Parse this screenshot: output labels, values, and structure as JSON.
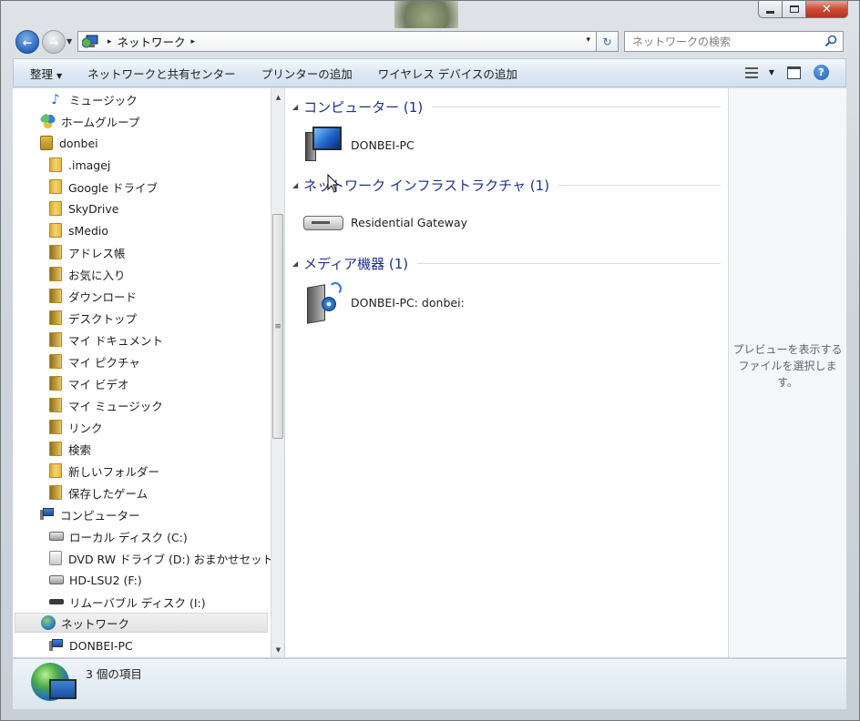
{
  "window": {
    "caption": {
      "minimize": "—",
      "maximize": "□",
      "close": "✕"
    }
  },
  "address": {
    "segments": [
      "ネットワーク"
    ],
    "separator": "▸",
    "dropdown": "▾",
    "refresh": "↻"
  },
  "search": {
    "placeholder": "ネットワークの検索"
  },
  "commandbar": {
    "items": [
      "整理",
      "ネットワークと共有センター",
      "プリンターの追加",
      "ワイヤレス デバイスの追加"
    ],
    "organize_arrow": "▼",
    "view_arrow": "▼",
    "help": "?"
  },
  "navpane": {
    "items": [
      {
        "label": "ミュージック",
        "icon": "music-note-icon"
      },
      {
        "label": "ホームグループ",
        "icon": "homegroup-icon"
      },
      {
        "label": "donbei",
        "icon": "user-folder-icon"
      },
      {
        "label": ".imagej",
        "icon": "folder-icon"
      },
      {
        "label": "Google ドライブ",
        "icon": "folder-icon"
      },
      {
        "label": "SkyDrive",
        "icon": "folder-icon"
      },
      {
        "label": "sMedio",
        "icon": "folder-icon"
      },
      {
        "label": "アドレス帳",
        "icon": "contacts-folder-icon"
      },
      {
        "label": "お気に入り",
        "icon": "favorites-folder-icon"
      },
      {
        "label": "ダウンロード",
        "icon": "downloads-folder-icon"
      },
      {
        "label": "デスクトップ",
        "icon": "desktop-folder-icon"
      },
      {
        "label": "マイ ドキュメント",
        "icon": "documents-folder-icon"
      },
      {
        "label": "マイ ピクチャ",
        "icon": "pictures-folder-icon"
      },
      {
        "label": "マイ ビデオ",
        "icon": "videos-folder-icon"
      },
      {
        "label": "マイ ミュージック",
        "icon": "music-folder-icon"
      },
      {
        "label": "リンク",
        "icon": "links-folder-icon"
      },
      {
        "label": "検索",
        "icon": "searches-folder-icon"
      },
      {
        "label": "新しいフォルダー",
        "icon": "folder-icon"
      },
      {
        "label": "保存したゲーム",
        "icon": "saved-games-folder-icon"
      },
      {
        "label": "コンピューター",
        "icon": "computer-icon"
      },
      {
        "label": "ローカル ディスク (C:)",
        "icon": "local-disk-icon"
      },
      {
        "label": "DVD RW ドライブ (D:) おまかせセット",
        "icon": "dvd-drive-icon"
      },
      {
        "label": "HD-LSU2 (F:)",
        "icon": "hard-drive-icon"
      },
      {
        "label": "リムーバブル ディスク (I:)",
        "icon": "removable-disk-icon"
      },
      {
        "label": "ネットワーク",
        "icon": "network-icon",
        "selected": true
      },
      {
        "label": "DONBEI-PC",
        "icon": "computer-icon"
      }
    ],
    "scroll_grip": "≡",
    "scroll_up": "▲",
    "scroll_down": "▼"
  },
  "content": {
    "groups": [
      {
        "title": "コンピューター (1)",
        "items": [
          {
            "label": "DONBEI-PC",
            "icon": "computer-icon"
          }
        ]
      },
      {
        "title": "ネットワーク インフラストラクチャ (1)",
        "items": [
          {
            "label": "Residential Gateway",
            "icon": "router-icon"
          }
        ]
      },
      {
        "title": "メディア機器 (1)",
        "items": [
          {
            "label": "DONBEI-PC: donbei:",
            "icon": "media-device-icon"
          }
        ]
      }
    ],
    "collapse_glyph": "◢"
  },
  "preview": {
    "text": "プレビューを表示するファイルを選択します。"
  },
  "details": {
    "status": "3 個の項目"
  },
  "colors": {
    "group_title": "#1e3287",
    "accent": "#2864b8",
    "close": "#cc4b33"
  }
}
